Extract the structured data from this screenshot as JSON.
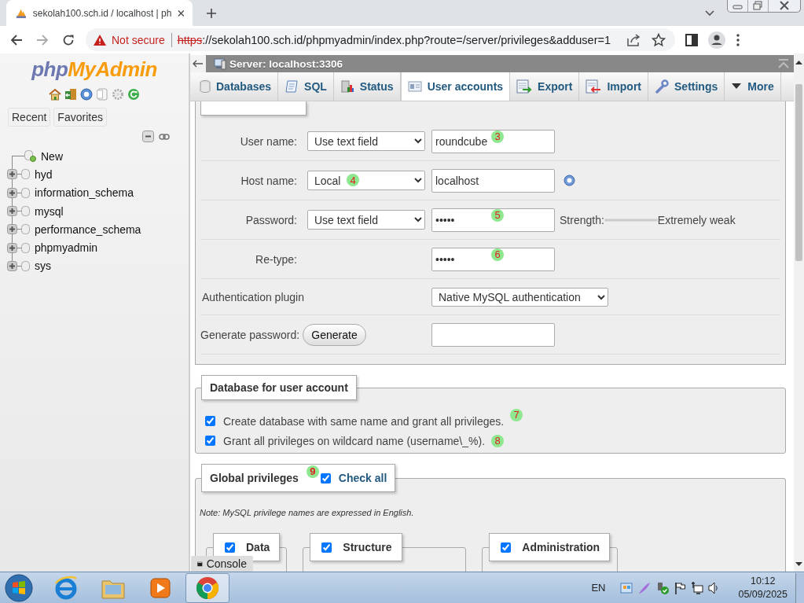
{
  "browser": {
    "tab_title": "sekolah100.sch.id / localhost | ph",
    "security_label": "Not secure",
    "url_scheme": "https",
    "url_rest": "://sekolah100.sch.id/phpmyadmin/index.php?route=/server/privileges&adduser=1"
  },
  "sidebar": {
    "logo_php": "php",
    "logo_myadmin": "MyAdmin",
    "tabs": [
      "Recent",
      "Favorites"
    ],
    "tree": [
      {
        "label": "New",
        "kind": "new"
      },
      {
        "label": "hyd",
        "kind": "db",
        "expanded": false
      },
      {
        "label": "information_schema",
        "kind": "db",
        "expanded": false
      },
      {
        "label": "mysql",
        "kind": "db",
        "expanded": false
      },
      {
        "label": "performance_schema",
        "kind": "db",
        "expanded": false
      },
      {
        "label": "phpmyadmin",
        "kind": "db",
        "expanded": false
      },
      {
        "label": "sys",
        "kind": "db",
        "expanded": false
      }
    ]
  },
  "server_bar": {
    "title": "Server: localhost:3306"
  },
  "tabs": [
    {
      "label": "Databases",
      "selected": false
    },
    {
      "label": "SQL",
      "selected": false
    },
    {
      "label": "Status",
      "selected": false
    },
    {
      "label": "User accounts",
      "selected": true
    },
    {
      "label": "Export",
      "selected": false
    },
    {
      "label": "Import",
      "selected": false
    },
    {
      "label": "Settings",
      "selected": false
    },
    {
      "label": "More",
      "selected": false
    }
  ],
  "login_information": {
    "rows": [
      {
        "kind": "select_input",
        "label": "User name:",
        "select": "Use text field",
        "value": "roundcube",
        "marker": "3"
      },
      {
        "kind": "select_input",
        "label": "Host name:",
        "select": "Local",
        "select_marker": "4",
        "value": "localhost",
        "help": true
      },
      {
        "kind": "select_input",
        "label": "Password:",
        "select": "Use text field",
        "value": "•••••",
        "marker": "5",
        "strength": {
          "label": "Strength:",
          "level": 0,
          "reading": "Extremely weak"
        }
      },
      {
        "kind": "input",
        "label": "Re-type:",
        "value": "•••••",
        "marker": "6"
      },
      {
        "kind": "plugin",
        "label": "Authentication plugin",
        "select": "Native MySQL authentication"
      },
      {
        "kind": "generate",
        "label": "Generate password:",
        "button": "Generate"
      }
    ]
  },
  "database_for_user_account": {
    "legend": "Database for user account",
    "options": [
      {
        "label": "Create database with same name and grant all privileges.",
        "checked": true,
        "marker": "7"
      },
      {
        "label": "Grant all privileges on wildcard name (username\\_%).",
        "checked": true,
        "marker": "8"
      }
    ]
  },
  "global_privileges": {
    "legend": "Global privileges",
    "marker": "9",
    "check_all": {
      "label": "Check all",
      "checked": true
    },
    "note": "Note: MySQL privilege names are expressed in English.",
    "groups": [
      {
        "label": "Data",
        "checked": true
      },
      {
        "label": "Structure",
        "checked": true
      },
      {
        "label": "Administration",
        "checked": true
      }
    ]
  },
  "console": {
    "label": "Console"
  },
  "taskbar": {
    "apps": [
      {
        "selected": false
      },
      {
        "selected": false
      },
      {
        "selected": false
      },
      {
        "selected": true
      }
    ],
    "language": "EN",
    "time": "10:12",
    "date": "05/09/2025"
  }
}
